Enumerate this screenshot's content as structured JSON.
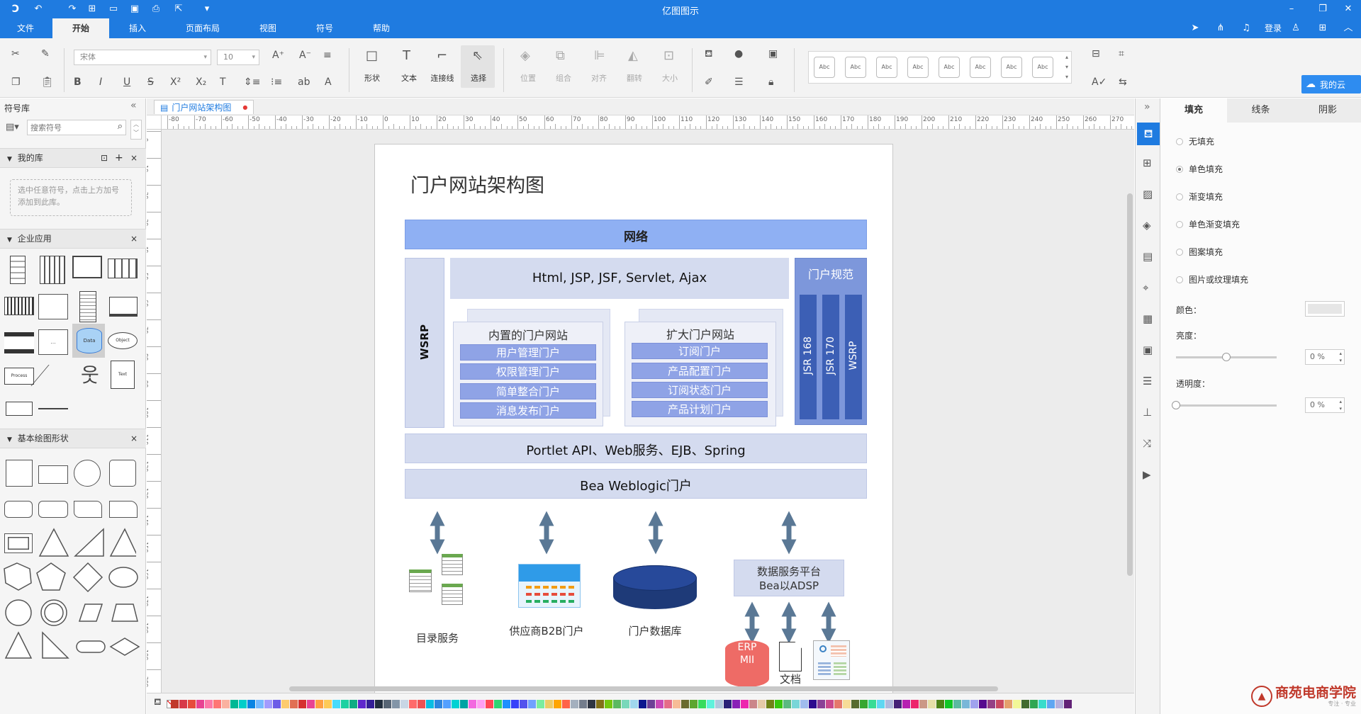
{
  "app": {
    "title": "亿图图示"
  },
  "menu": {
    "items": [
      "文件",
      "开始",
      "插入",
      "页面布局",
      "视图",
      "符号",
      "帮助"
    ],
    "active": "开始",
    "login": "登录"
  },
  "ribbon": {
    "font_name": "宋体",
    "font_size": "10",
    "tools": {
      "shape": "形状",
      "text": "文本",
      "connector": "连接线",
      "select": "选择",
      "position": "位置",
      "group": "组合",
      "align": "对齐",
      "flip": "翻转",
      "size": "大小"
    },
    "style_sample": "Abc",
    "share_label": "我的云"
  },
  "left_panel": {
    "title": "符号库",
    "search_placeholder": "搜索符号",
    "my_library": "我的库",
    "my_library_hint": "选中任意符号，点击上方加号添加到此库。",
    "section_enterprise": "企业应用",
    "section_basic": "基本绘图形状",
    "shape_labels": {
      "data": "Data",
      "object": "Object",
      "process": "Process",
      "text": "Text"
    }
  },
  "document": {
    "tab_name": "门户网站架构图"
  },
  "ruler": {
    "h_ticks": [
      "-80",
      "-70",
      "-60",
      "-50",
      "-40",
      "-30",
      "-20",
      "-10",
      "0",
      "10",
      "20",
      "30",
      "40",
      "50",
      "60",
      "70",
      "80",
      "90",
      "100",
      "110",
      "120",
      "130",
      "140",
      "150",
      "160",
      "170",
      "180",
      "190",
      "200",
      "210",
      "220",
      "230",
      "240",
      "250",
      "260",
      "270"
    ],
    "v_ticks": [
      "0",
      "10",
      "20",
      "30",
      "40",
      "50",
      "60",
      "70",
      "80",
      "90",
      "100",
      "110",
      "120",
      "130",
      "140",
      "150",
      "160",
      "170",
      "180",
      "190",
      "200"
    ]
  },
  "diagram": {
    "title": "门户网站架构图",
    "network": "网络",
    "wsrp": "WSRP",
    "web_tech": "Html, JSP, JSF, Servlet, Ajax",
    "portal_spec": "门户规范",
    "spec_items": [
      "JSR 168",
      "JSR 170",
      "WSRP"
    ],
    "internal_portal": {
      "title": "内置的门户网站",
      "items": [
        "用户管理门户",
        "权限管理门户",
        "简单整合门户",
        "消息发布门户"
      ]
    },
    "extended_portal": {
      "title": "扩大门户网站",
      "items": [
        "订阅门户",
        "产品配置门户",
        "订阅状态门户",
        "产品计划门户"
      ]
    },
    "portlet_layer": "Portlet API、Web服务、EJB、Spring",
    "weblogic": "Bea Weblogic门户",
    "bottom": {
      "directory": "目录服务",
      "supplier": "供应商B2B门户",
      "database": "门户数据库",
      "data_platform_line1": "数据服务平台",
      "data_platform_line2": "Bea以ADSP",
      "erp_line1": "ERP",
      "erp_line2": "MII",
      "docs": "文档"
    }
  },
  "right_panel": {
    "tabs": [
      "填充",
      "线条",
      "阴影"
    ],
    "active_tab": "填充",
    "fill_options": [
      "无填充",
      "单色填充",
      "渐变填充",
      "单色渐变填充",
      "图案填充",
      "图片或纹理填充"
    ],
    "selected_fill": "单色填充",
    "color_label": "颜色：",
    "brightness_label": "亮度：",
    "brightness_value": "0 %",
    "brightness": 0.5,
    "transparency_label": "透明度：",
    "transparency_value": "0 %",
    "transparency": 0
  },
  "watermark": {
    "text": "商苑电商学院",
    "sub": "专注 · 专业"
  },
  "colors": {
    "brand": "#1f7be0",
    "network_bar": "#8fb0f3",
    "item_box": "#8fa3e6",
    "spec_box": "#3c5fb5",
    "db": "#1e3a78",
    "arrow": "#5a7895"
  },
  "palette_colors": [
    "#c0392b",
    "#d73a49",
    "#e74c3c",
    "#e84393",
    "#fd79a8",
    "#ff7675",
    "#fab1a0",
    "#00b894",
    "#00cec9",
    "#0984e3",
    "#74b9ff",
    "#a29bfe",
    "#6c5ce7",
    "#fdcb6e",
    "#e17055",
    "#d63031",
    "#e84393",
    "#ff9f43",
    "#feca57",
    "#48dbfb",
    "#1dd1a1",
    "#10ac84",
    "#5f27cd",
    "#341f97",
    "#222f3e",
    "#576574",
    "#8395a7",
    "#c8d6e5",
    "#ff6b6b",
    "#ee5253",
    "#0abde3",
    "#2e86de",
    "#54a0ff",
    "#00d2d3",
    "#01a3a4",
    "#f368e0",
    "#ff9ff3",
    "#ff4757",
    "#2ed573",
    "#1e90ff",
    "#3742fa",
    "#5352ed",
    "#70a1ff",
    "#7bed9f",
    "#eccc68",
    "#ffa502",
    "#ff6348",
    "#a4b0be",
    "#747d8c",
    "#2f3542"
  ]
}
